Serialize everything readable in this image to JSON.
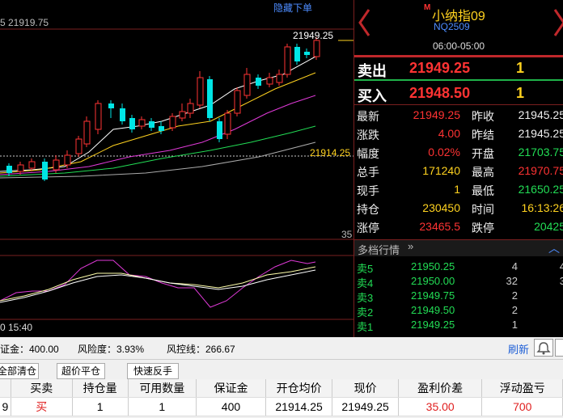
{
  "chart": {
    "header_value": "5 21919.75",
    "hide_order_link": "隐藏下单",
    "high_label": "21949.25",
    "avg_price_label": "21914.25",
    "volume_scale_label": "35",
    "time_label": "0 15:40"
  },
  "quote": {
    "name": "小纳指09",
    "code": "NQ2509",
    "session": "06:00-05:00",
    "m_badge": "M",
    "ask": {
      "label": "卖出",
      "price": "21949.25",
      "qty": "1"
    },
    "bid": {
      "label": "买入",
      "price": "21948.50",
      "qty": "1"
    },
    "stats": [
      {
        "l1": "最新",
        "v1": "21949.25",
        "c1": "red",
        "l2": "昨收",
        "v2": "21945.25",
        "c2": "white"
      },
      {
        "l1": "涨跌",
        "v1": "4.00",
        "c1": "red",
        "l2": "昨结",
        "v2": "21945.25",
        "c2": "white"
      },
      {
        "l1": "幅度",
        "v1": "0.02%",
        "c1": "red",
        "l2": "开盘",
        "v2": "21703.75",
        "c2": "green"
      },
      {
        "l1": "总手",
        "v1": "171240",
        "c1": "yellow",
        "l2": "最高",
        "v2": "21970.75",
        "c2": "red"
      },
      {
        "l1": "现手",
        "v1": "1",
        "c1": "yellow",
        "l2": "最低",
        "v2": "21650.25",
        "c2": "green"
      },
      {
        "l1": "持仓",
        "v1": "230450",
        "c1": "yellow",
        "l2": "时间",
        "v2": "16:13:26",
        "c2": "yellow"
      },
      {
        "l1": "涨停",
        "v1": "23465.5",
        "c1": "red",
        "l2": "跌停",
        "v2": "20425",
        "c2": "green"
      }
    ],
    "depth_title": "多档行情",
    "depth": [
      {
        "label": "卖5",
        "price": "21950.25",
        "qty": "4",
        "qty2": "4"
      },
      {
        "label": "卖4",
        "price": "21950.00",
        "qty": "32",
        "qty2": "3"
      },
      {
        "label": "卖3",
        "price": "21949.75",
        "qty": "2",
        "qty2": ""
      },
      {
        "label": "卖2",
        "price": "21949.50",
        "qty": "2",
        "qty2": ""
      },
      {
        "label": "卖1",
        "price": "21949.25",
        "qty": "1",
        "qty2": ""
      }
    ]
  },
  "account": {
    "margin": "证金：400.00",
    "risk": "风险度：3.93%",
    "control_line": "风控线：266.67",
    "refresh": "刷新"
  },
  "buttons": {
    "close_all": "全部清仓",
    "super_close": "超价平仓",
    "quick_reverse": "快速反手"
  },
  "positions": {
    "headers": [
      "",
      "买卖",
      "持仓量",
      "可用数量",
      "保证金",
      "开仓均价",
      "现价",
      "盈利价差",
      "浮动盈亏"
    ],
    "rows": [
      {
        "sym": "9",
        "side": "买",
        "qty": "1",
        "avail": "1",
        "margin": "400",
        "open": "21914.25",
        "price": "21949.25",
        "diff": "35.00",
        "pnl": "700"
      }
    ]
  },
  "colors": {
    "up": "#ff3333",
    "down": "#22dd55",
    "accent": "#ffd21f",
    "candle_down": "#00e5e5"
  }
}
